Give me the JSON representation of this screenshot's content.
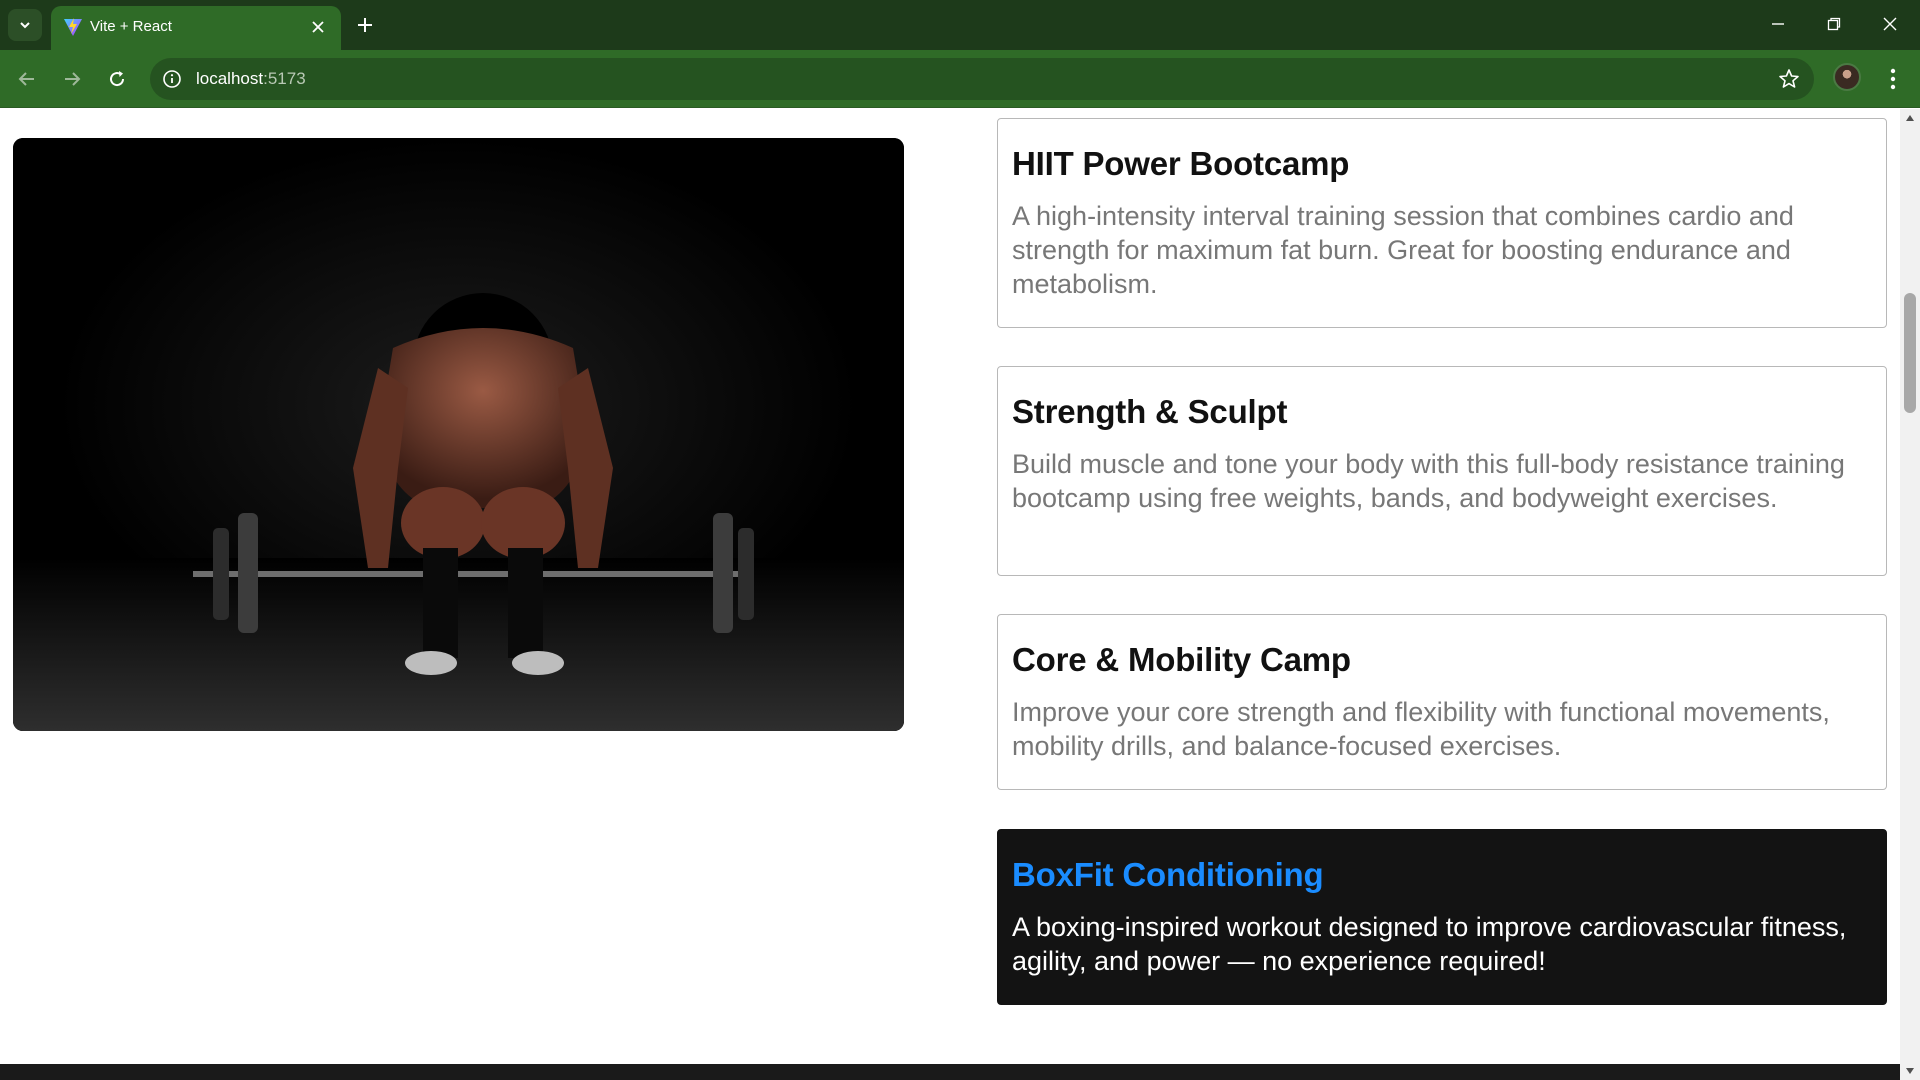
{
  "browser": {
    "tab_title": "Vite + React",
    "url_host": "localhost",
    "url_port": ":5173",
    "theme_color": "#2f6b27"
  },
  "page": {
    "hero_image_alt": "Man preparing to deadlift a barbell in a dark gym",
    "programs": [
      {
        "title": "HIIT Power Bootcamp",
        "description": "A high-intensity interval training session that combines cardio and strength for maximum fat burn. Great for boosting endurance and metabolism."
      },
      {
        "title": "Strength & Sculpt",
        "description": "Build muscle and tone your body with this full-body resistance training bootcamp using free weights, bands, and bodyweight exercises."
      },
      {
        "title": "Core & Mobility Camp",
        "description": "Improve your core strength and flexibility with functional movements, mobility drills, and balance-focused exercises."
      },
      {
        "title": "BoxFit Conditioning",
        "description": "A boxing-inspired workout designed to improve cardiovascular fitness, agility, and power — no experience required!"
      }
    ],
    "accent_color": "#1a8cff",
    "active_card_bg": "#131313"
  }
}
